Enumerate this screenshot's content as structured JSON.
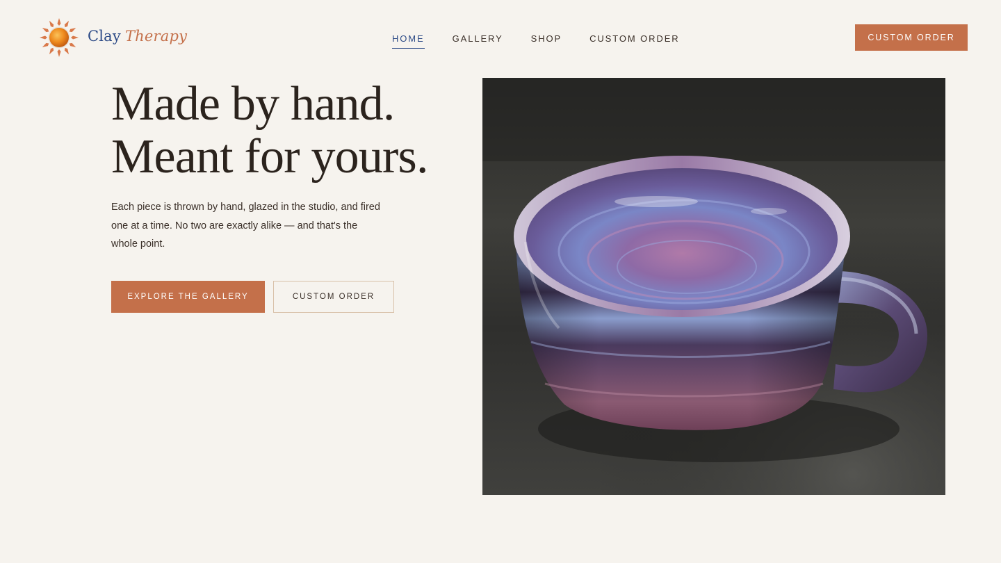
{
  "brand": {
    "name_part1": "Clay",
    "name_part2": "Therapy",
    "logo_icon": "sun-icon"
  },
  "nav": {
    "items": [
      {
        "label": "HOME",
        "active": true
      },
      {
        "label": "GALLERY",
        "active": false
      },
      {
        "label": "SHOP",
        "active": false
      },
      {
        "label": "CUSTOM ORDER",
        "active": false
      }
    ],
    "cta_label": "CUSTOM ORDER"
  },
  "hero": {
    "title_line1": "Made by hand.",
    "title_line2": "Meant for yours.",
    "description": "Each piece is thrown by hand, glazed in the studio, and fired one at a time. No two are exactly alike — and that's the whole point.",
    "primary_button": "EXPLORE THE GALLERY",
    "secondary_button": "CUSTOM ORDER",
    "image_subject": "purple-glazed-ceramic-mug"
  },
  "colors": {
    "background": "#f6f3ee",
    "accent": "#c4704a",
    "brand_blue": "#2c4a86",
    "text": "#2b231d",
    "outline": "#d8c0a8"
  }
}
